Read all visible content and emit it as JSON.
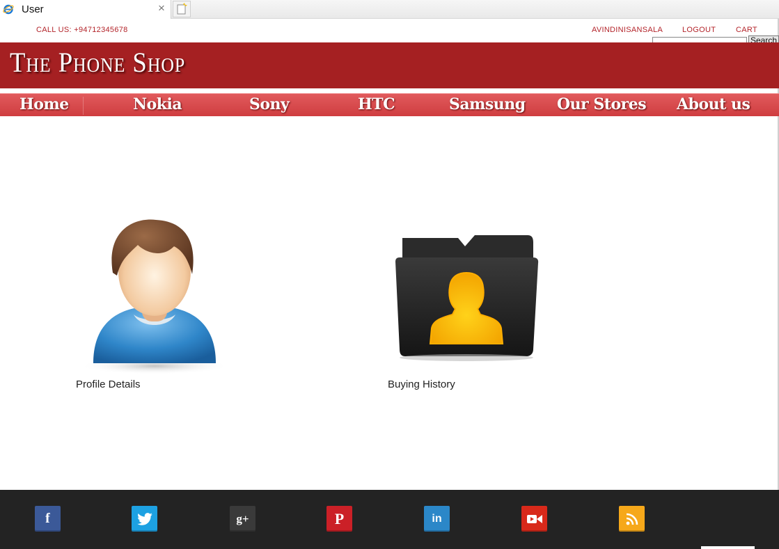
{
  "browser": {
    "tab_title": "User",
    "close_glyph": "×"
  },
  "topbar": {
    "call": "CALL US: +94712345678",
    "user": "AVINDINISANSALA",
    "logout": "LOGOUT",
    "cart": "CART",
    "search_value": "",
    "search_button": "Search"
  },
  "header": {
    "logo": "The Phone Shop",
    "nav": [
      "Home",
      "Nokia",
      "Sony",
      "HTC",
      "Samsung",
      "Our Stores",
      "About us"
    ]
  },
  "content": {
    "profile_label": "Profile Details",
    "history_label": "Buying History"
  },
  "footer": {
    "social": [
      {
        "name": "facebook-icon",
        "glyph": "f",
        "color": "#3b5998"
      },
      {
        "name": "twitter-icon",
        "glyph": "🐦",
        "color": "#1da1e2"
      },
      {
        "name": "google-plus-icon",
        "glyph": "g+",
        "color": "#3a3a3a"
      },
      {
        "name": "pinterest-icon",
        "glyph": "P",
        "color": "#cb2027"
      },
      {
        "name": "linkedin-icon",
        "glyph": "in",
        "color": "#2b87c8"
      },
      {
        "name": "video-icon",
        "glyph": "▶",
        "color": "#d8291a"
      },
      {
        "name": "rss-icon",
        "glyph": "RSS",
        "color": "#f6a81a"
      }
    ]
  },
  "colors": {
    "brand_red": "#a52022",
    "nav_red": "#d84a4d",
    "footer_bg": "#232323"
  }
}
